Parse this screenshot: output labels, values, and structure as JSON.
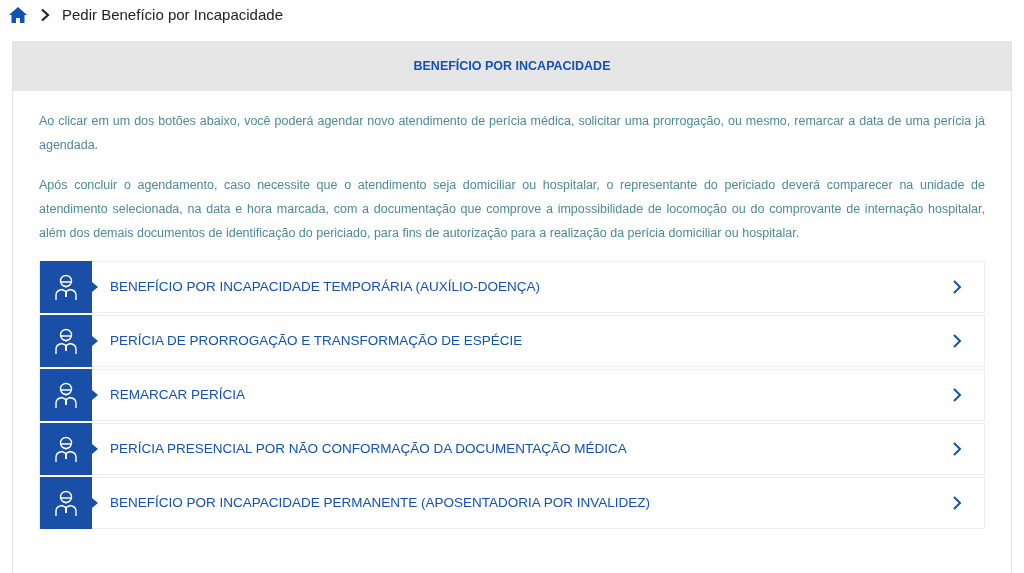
{
  "breadcrumb": {
    "current": "Pedir Benefício por Incapacidade"
  },
  "panel": {
    "title": "BENEFÍCIO POR INCAPACIDADE",
    "paragraphs": [
      "Ao clicar em um dos botões abaixo, você poderá agendar novo atendimento de perícia médica, solicitar uma prorrogação, ou mesmo, remarcar a data de uma perícia já agendada.",
      "Após concluir o agendamento, caso necessite que o atendimento seja domiciliar ou hospitalar, o representante do periciado deverá comparecer na unidade de atendimento selecionada, na data e hora marcada, com a documentação que comprove a impossibilidade de locomoção ou do comprovante de internação hospitalar, além dos demais documentos de identificação do periciado, para fins de autorização para a realização da perícia domiciliar ou hospitalar."
    ],
    "options": [
      {
        "label": "BENEFÍCIO POR INCAPACIDADE TEMPORÁRIA (AUXÍLIO-DOENÇA)"
      },
      {
        "label": "PERÍCIA DE PRORROGAÇÃO E TRANSFORMAÇÃO DE ESPÉCIE"
      },
      {
        "label": "REMARCAR PERÍCIA"
      },
      {
        "label": "PERÍCIA PRESENCIAL POR NÃO CONFORMAÇÃO DA DOCUMENTAÇÃO MÉDICA"
      },
      {
        "label": "BENEFÍCIO POR INCAPACIDADE PERMANENTE (APOSENTADORIA POR INVALIDEZ)"
      }
    ]
  }
}
